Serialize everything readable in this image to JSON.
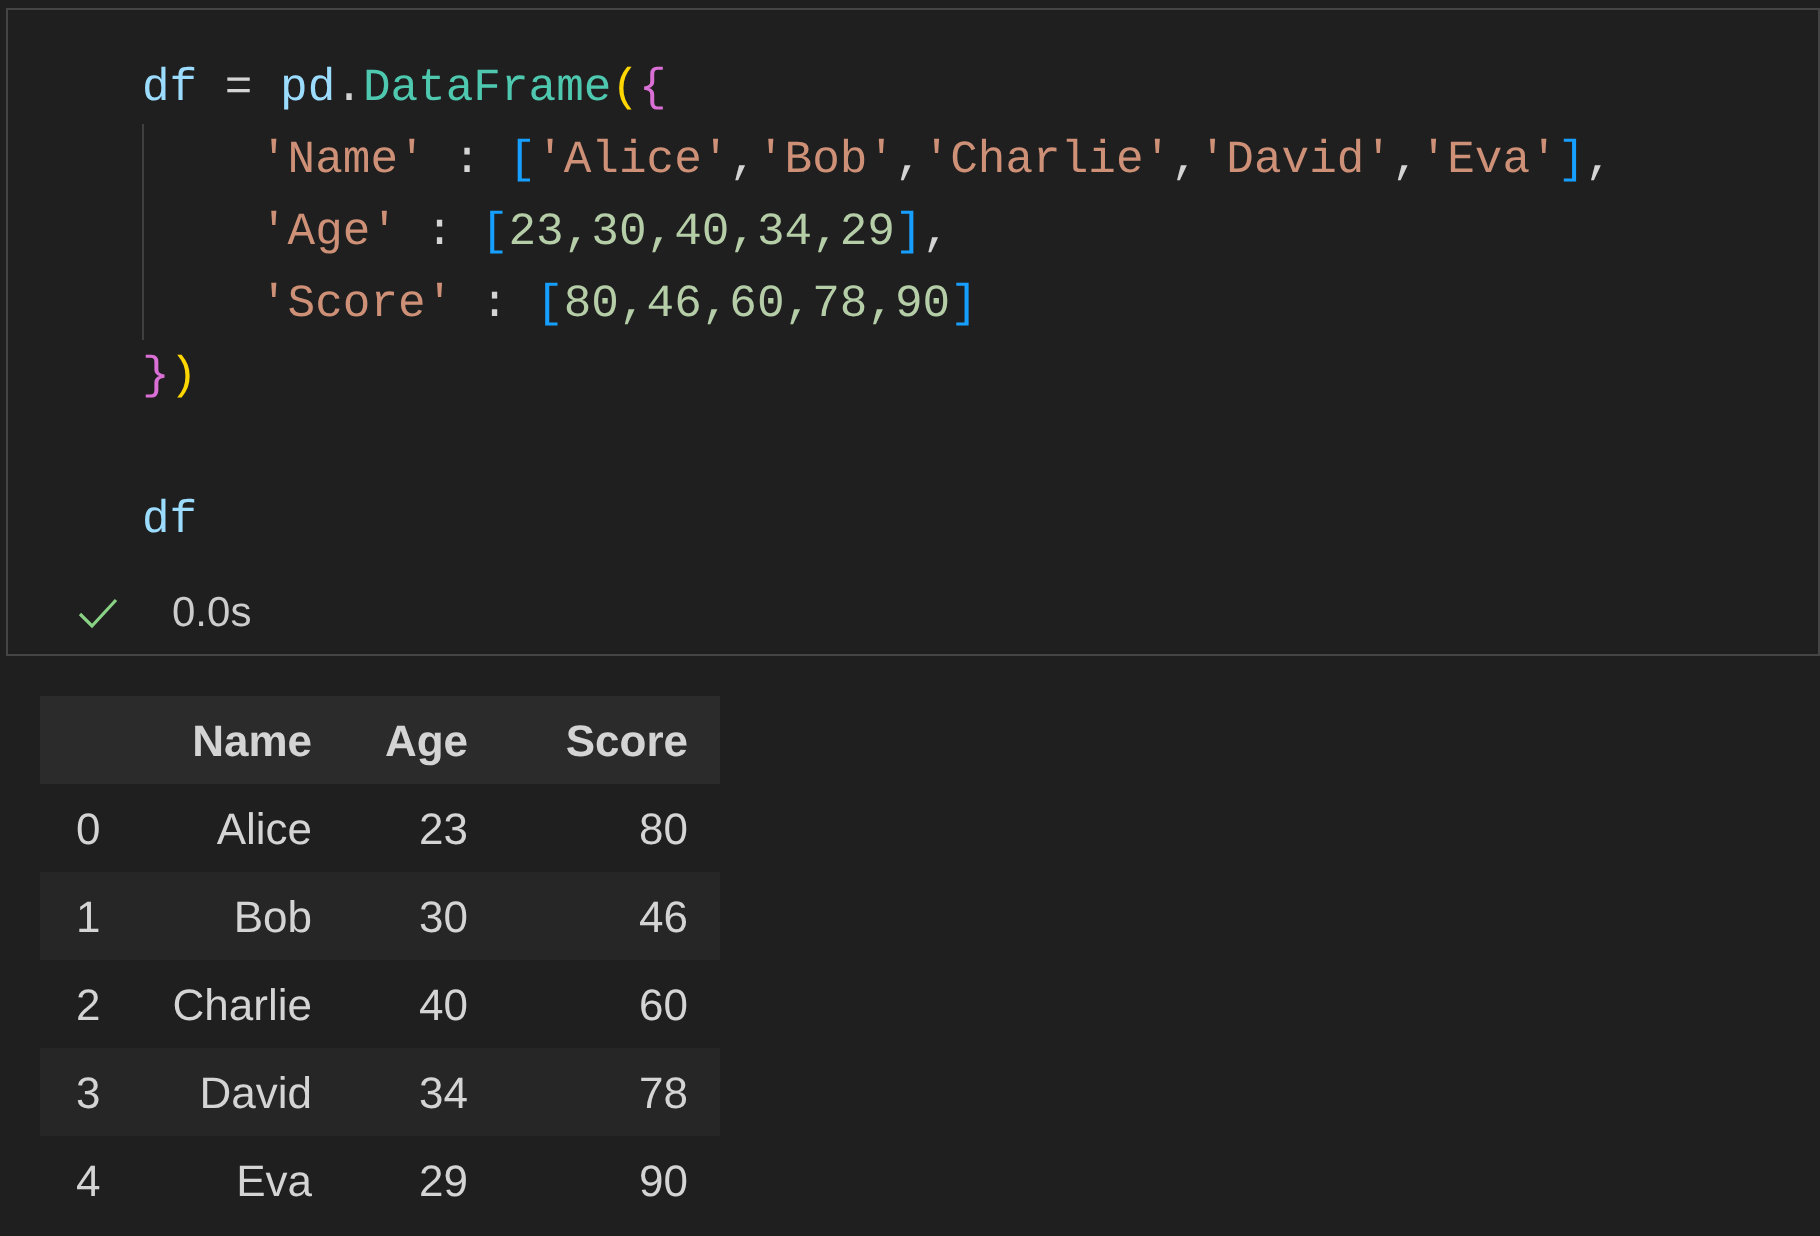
{
  "cell": {
    "statements": [
      {
        "lines": [
          {
            "tokens": [
              {
                "text": "df",
                "kind": "variable"
              },
              {
                "text": " = ",
                "kind": "operator"
              },
              {
                "text": "pd",
                "kind": "variable"
              },
              {
                "text": ".",
                "kind": "operator"
              },
              {
                "text": "DataFrame",
                "kind": "class"
              },
              {
                "text": "(",
                "kind": "paren"
              },
              {
                "text": "{",
                "kind": "brace"
              }
            ],
            "children": [
              {
                "tokens": [
                  {
                    "text": "'Name'",
                    "kind": "string"
                  },
                  {
                    "text": " : ",
                    "kind": "operator"
                  },
                  {
                    "text": "[",
                    "kind": "bracket"
                  },
                  {
                    "text": "'Alice'",
                    "kind": "string"
                  },
                  {
                    "text": ",",
                    "kind": "operator"
                  },
                  {
                    "text": "'Bob'",
                    "kind": "string"
                  },
                  {
                    "text": ",",
                    "kind": "operator"
                  },
                  {
                    "text": "'Charlie'",
                    "kind": "string"
                  },
                  {
                    "text": ",",
                    "kind": "operator"
                  },
                  {
                    "text": "'David'",
                    "kind": "string"
                  },
                  {
                    "text": ",",
                    "kind": "operator"
                  },
                  {
                    "text": "'Eva'",
                    "kind": "string"
                  },
                  {
                    "text": "]",
                    "kind": "bracket"
                  },
                  {
                    "text": ",",
                    "kind": "operator"
                  }
                ]
              },
              {
                "tokens": [
                  {
                    "text": "'Age'",
                    "kind": "string"
                  },
                  {
                    "text": " : ",
                    "kind": "operator"
                  },
                  {
                    "text": "[",
                    "kind": "bracket"
                  },
                  {
                    "text": "23,30,40,34,29",
                    "kind": "number"
                  },
                  {
                    "text": "]",
                    "kind": "bracket"
                  },
                  {
                    "text": ",",
                    "kind": "operator"
                  }
                ]
              },
              {
                "tokens": [
                  {
                    "text": "'Score'",
                    "kind": "string"
                  },
                  {
                    "text": " : ",
                    "kind": "operator"
                  },
                  {
                    "text": "[",
                    "kind": "bracket"
                  },
                  {
                    "text": "80,46,60,78,90",
                    "kind": "number"
                  },
                  {
                    "text": "]",
                    "kind": "bracket"
                  }
                ]
              }
            ]
          },
          {
            "tokens": [
              {
                "text": "}",
                "kind": "brace"
              },
              {
                "text": ")",
                "kind": "paren"
              }
            ]
          }
        ]
      },
      {
        "lines": [
          {
            "tokens": [
              {
                "text": "df",
                "kind": "variable"
              }
            ]
          }
        ]
      }
    ],
    "status": {
      "succeeded": true,
      "duration": "0.0s"
    }
  },
  "output": {
    "table": {
      "columns": [
        "Name",
        "Age",
        "Score"
      ],
      "rows": [
        {
          "index": "0",
          "cells": [
            "Alice",
            "23",
            "80"
          ]
        },
        {
          "index": "1",
          "cells": [
            "Bob",
            "30",
            "46"
          ]
        },
        {
          "index": "2",
          "cells": [
            "Charlie",
            "40",
            "60"
          ]
        },
        {
          "index": "3",
          "cells": [
            "David",
            "34",
            "78"
          ]
        },
        {
          "index": "4",
          "cells": [
            "Eva",
            "29",
            "90"
          ]
        }
      ]
    }
  }
}
